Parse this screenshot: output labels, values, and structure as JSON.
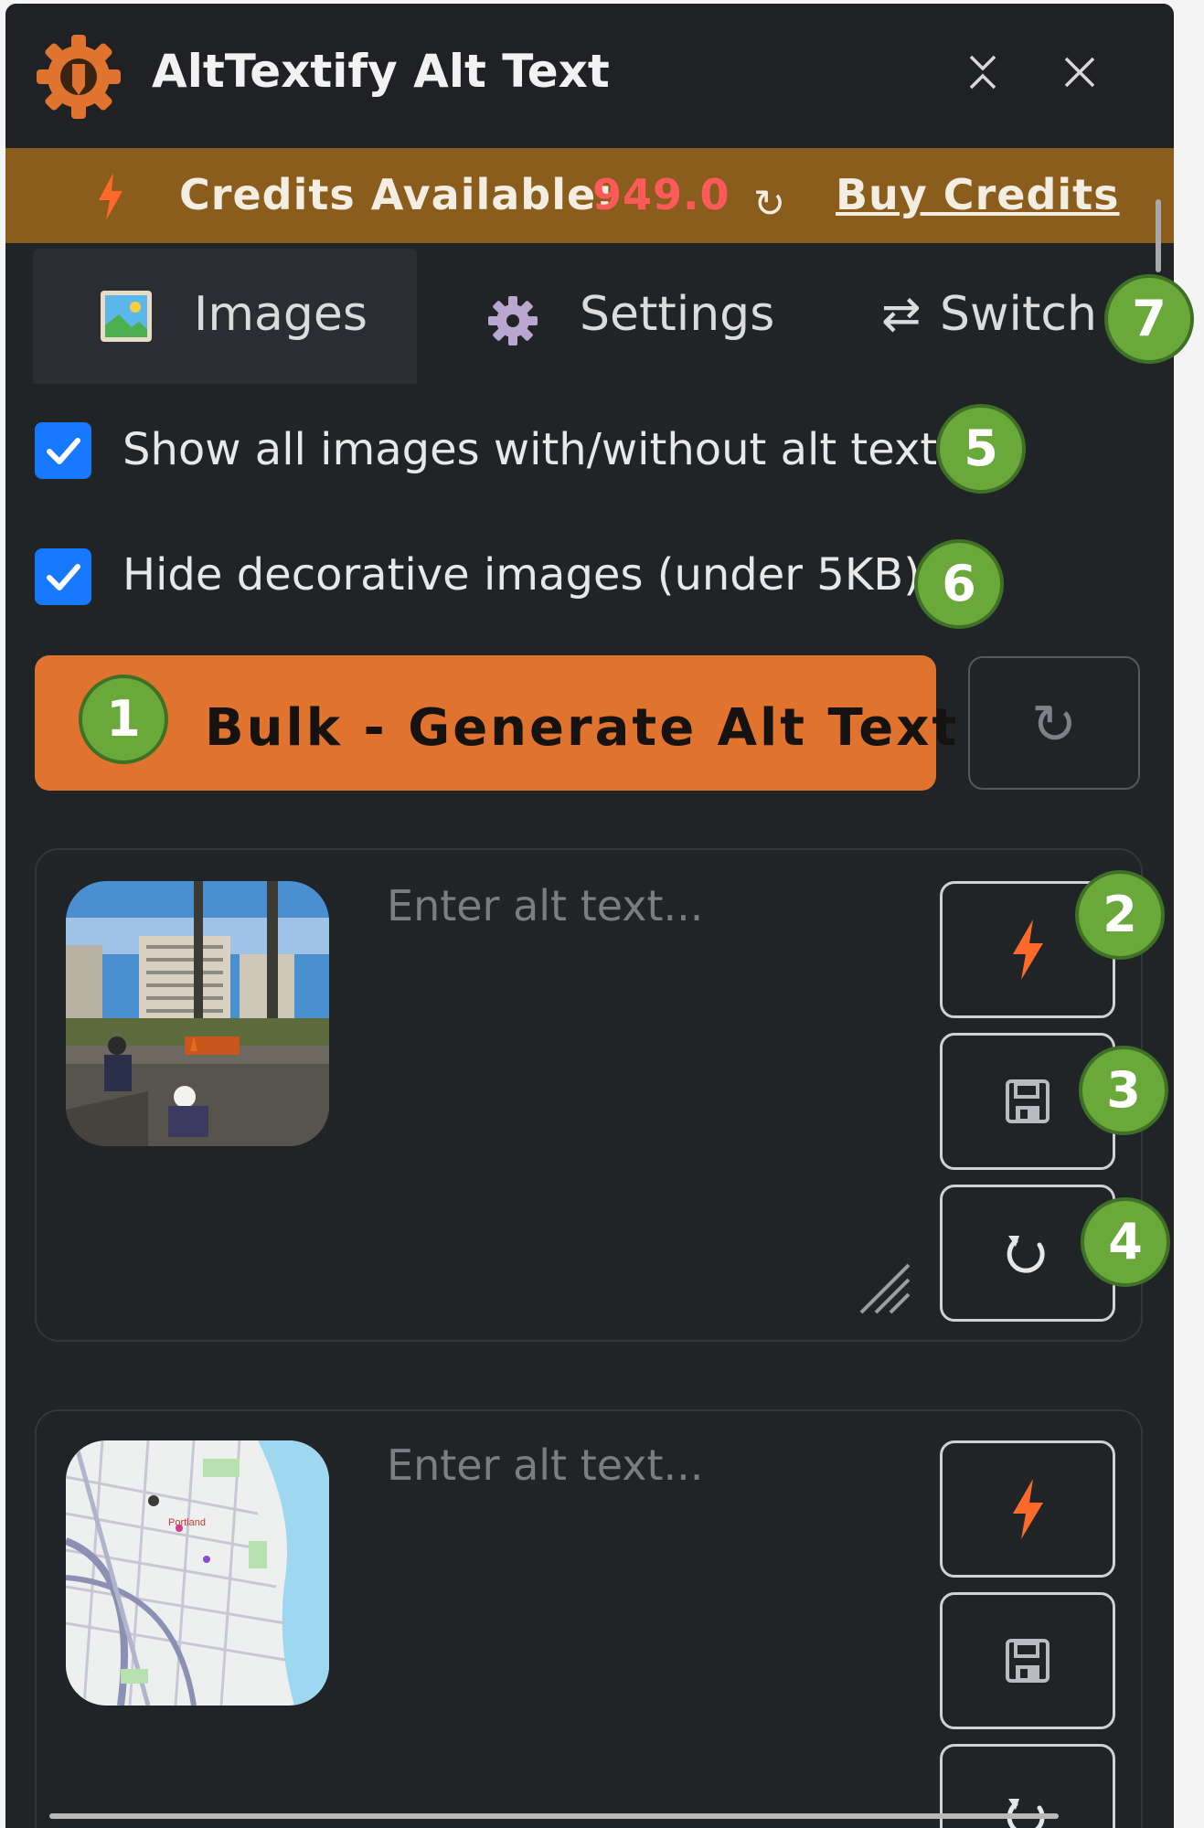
{
  "window": {
    "title": "AltTextify Alt Text",
    "collapse_icon": "collapse-icon",
    "close_icon": "close-icon"
  },
  "credits": {
    "label": "Credits Available:",
    "value": "949.0",
    "refresh_glyph": "↻",
    "buy_label": "Buy Credits"
  },
  "tabs": [
    {
      "label": "Images",
      "icon": "picture-icon",
      "active": true
    },
    {
      "label": "Settings",
      "icon": "gear-icon",
      "active": false
    },
    {
      "label": "Switch",
      "glyph": "⇄",
      "icon": "switch-icon",
      "active": false
    }
  ],
  "options": {
    "show_all_label": "Show all images with/without alt text",
    "show_all_checked": true,
    "hide_decorative_label": "Hide decorative images (under 5KB)",
    "hide_decorative_checked": true
  },
  "bulk": {
    "label": "Bulk - Generate Alt Text",
    "refresh_glyph": "↻"
  },
  "images": [
    {
      "thumbnail": "construction-site-photo",
      "alt_text": "",
      "placeholder": "Enter alt text..."
    },
    {
      "thumbnail": "city-map-portland",
      "map_label": "Portland",
      "alt_text": "",
      "placeholder": "Enter alt text..."
    }
  ],
  "callouts": [
    "1",
    "2",
    "3",
    "4",
    "5",
    "6",
    "7"
  ],
  "colors": {
    "accent_orange": "#e0742e",
    "credits_banner": "#8a5d1d",
    "credits_value": "#ff5a5a",
    "checkbox_blue": "#1779ff",
    "callout_green": "#6aa83a"
  }
}
